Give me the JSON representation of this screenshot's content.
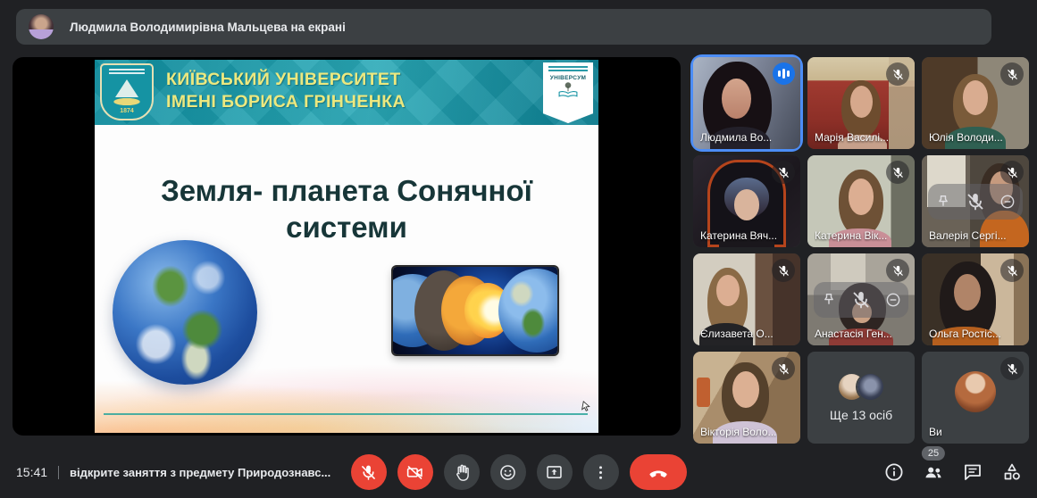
{
  "colors": {
    "background": "#202124",
    "surface": "#3c4043",
    "accent_red": "#ea4335",
    "active_speaker_border": "#4c8df6",
    "speaking_indicator_blue": "#1a73e8",
    "banner_teal": "#1593a3",
    "banner_text_yellow": "#ece87f",
    "slide_title_color": "#173638",
    "icon_color": "#e8eaed"
  },
  "screen_share_banner": {
    "text": "Людмила Володимирівна Мальцева на екрані"
  },
  "slide": {
    "university_line1": "КИЇВСЬКИЙ УНІВЕРСИТЕТ",
    "university_line2": "ІМЕНІ БОРИСА ГРІНЧЕНКА",
    "logo_year": "1874",
    "badge_title": "УНІВЕРСУМ",
    "title_line1": "Земля- планета Сонячної",
    "title_line2": "системи"
  },
  "participants": [
    {
      "name": "Людмила Во...",
      "muted": false,
      "speaking": true,
      "active_speaker": true
    },
    {
      "name": "Марія Василі...",
      "muted": true
    },
    {
      "name": "Юлія Володи...",
      "muted": true
    },
    {
      "name": "Катерина Вяч...",
      "muted": true
    },
    {
      "name": "Катерина Вік...",
      "muted": true
    },
    {
      "name": "Валерія Сергі...",
      "muted": true,
      "hover_controls": true
    },
    {
      "name": "Єлизавета О...",
      "muted": true
    },
    {
      "name": "Анастасія Ген...",
      "muted": true,
      "hover_controls": true
    },
    {
      "name": "Ольга Ростіс...",
      "muted": true
    },
    {
      "name": "Вікторія Воло...",
      "muted": true
    },
    {
      "name": "Ще 13 осіб",
      "overflow_tile": true
    },
    {
      "name": "Ви",
      "muted": true,
      "is_you": true
    }
  ],
  "bottom_bar": {
    "time": "15:41",
    "meeting_title": "відкрите заняття з предмету Природознавс...",
    "participant_count": "25"
  }
}
